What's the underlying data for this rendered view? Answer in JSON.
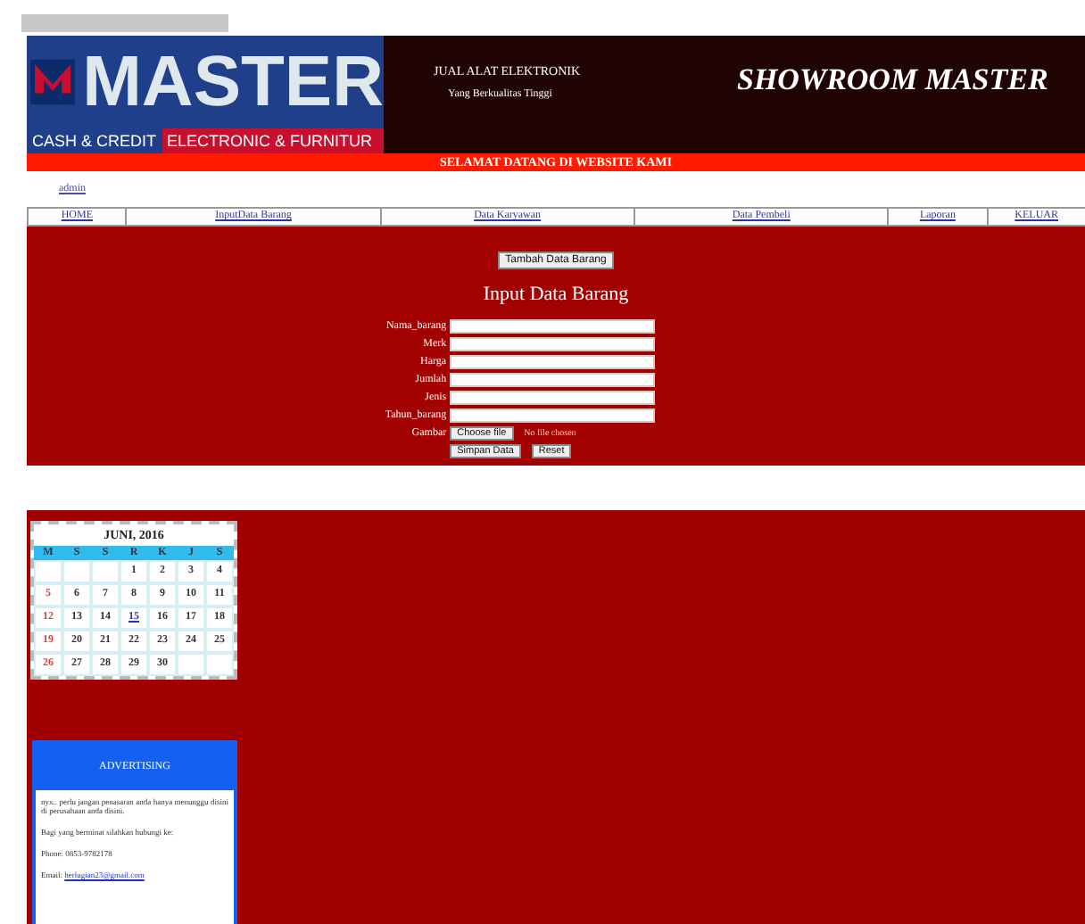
{
  "logo": {
    "brand": "MASTER",
    "left_tag": "CASH & CREDIT",
    "right_tag": "ELECTRONIC & FURNITUR"
  },
  "header": {
    "tagline": "JUAL ALAT ELEKTRONIK",
    "subtagline": "Yang Berkualitas Tinggi",
    "title": "SHOWROOM MASTER"
  },
  "welcome": "SELAMAT DATANG DI WEBSITE KAMI",
  "user_link": "admin",
  "nav": [
    "HOME",
    "InputData Barang",
    "Data Karyawan",
    "Data Pembeli",
    "Laporan",
    "KELUAR"
  ],
  "form": {
    "top_button": "Tambah Data Barang",
    "title": "Input Data Barang",
    "fields": [
      {
        "label": "Nama_barang",
        "kind": "text"
      },
      {
        "label": "Merk",
        "kind": "text"
      },
      {
        "label": "Harga",
        "kind": "text"
      },
      {
        "label": "Jumlah",
        "kind": "text"
      },
      {
        "label": "Jenis",
        "kind": "text"
      },
      {
        "label": "Tahun_barang",
        "kind": "text"
      },
      {
        "label": "Gambar",
        "kind": "file",
        "button": "Choose file",
        "status": "No file chosen"
      }
    ],
    "buttons": [
      "Simpan Data",
      "Reset"
    ]
  },
  "calendar": {
    "title": "JUNI, 2016",
    "weekdays": [
      "M",
      "S",
      "S",
      "R",
      "K",
      "J",
      "S"
    ],
    "weeks": [
      [
        {
          "kind": "empty"
        },
        {
          "kind": "empty"
        },
        {
          "kind": "empty"
        },
        {
          "day": "1",
          "kind": "normal"
        },
        {
          "day": "2",
          "kind": "normal"
        },
        {
          "day": "3",
          "kind": "normal"
        },
        {
          "day": "4",
          "kind": "normal"
        }
      ],
      [
        {
          "day": "5",
          "kind": "sunday"
        },
        {
          "day": "6",
          "kind": "normal"
        },
        {
          "day": "7",
          "kind": "normal"
        },
        {
          "day": "8",
          "kind": "normal"
        },
        {
          "day": "9",
          "kind": "normal"
        },
        {
          "day": "10",
          "kind": "normal"
        },
        {
          "day": "11",
          "kind": "normal"
        }
      ],
      [
        {
          "day": "12",
          "kind": "sunday"
        },
        {
          "day": "13",
          "kind": "normal"
        },
        {
          "day": "14",
          "kind": "normal"
        },
        {
          "day": "15",
          "kind": "today"
        },
        {
          "day": "16",
          "kind": "normal"
        },
        {
          "day": "17",
          "kind": "normal"
        },
        {
          "day": "18",
          "kind": "normal"
        }
      ],
      [
        {
          "day": "19",
          "kind": "sunday"
        },
        {
          "day": "20",
          "kind": "normal"
        },
        {
          "day": "21",
          "kind": "normal"
        },
        {
          "day": "22",
          "kind": "normal"
        },
        {
          "day": "23",
          "kind": "normal"
        },
        {
          "day": "24",
          "kind": "normal"
        },
        {
          "day": "25",
          "kind": "normal"
        }
      ],
      [
        {
          "day": "26",
          "kind": "sunday"
        },
        {
          "day": "27",
          "kind": "normal"
        },
        {
          "day": "28",
          "kind": "normal"
        },
        {
          "day": "29",
          "kind": "normal"
        },
        {
          "day": "30",
          "kind": "normal"
        },
        {
          "kind": "empty"
        },
        {
          "kind": "empty"
        }
      ]
    ]
  },
  "advertising": {
    "title": "ADVERTISING",
    "text": "nyx.. perlu jangan penasaran anda hanya menunggu disini di perusahaan anda disini.",
    "note": "Bagi yang berminat silahkan hubungi ke:",
    "phone": "Phone: 0853-9782178",
    "email_label": "Email:",
    "email": "herlugian23@gmail.com"
  }
}
